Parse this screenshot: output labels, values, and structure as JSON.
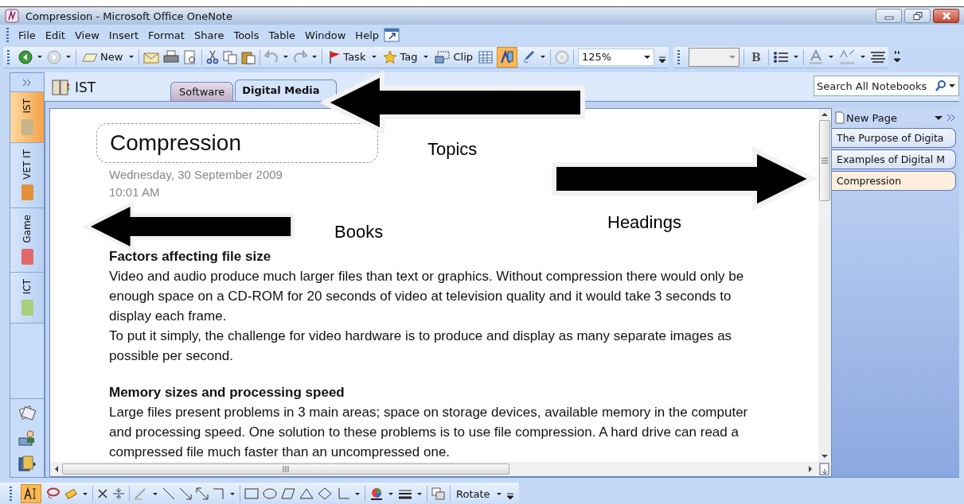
{
  "window": {
    "title": "Compression - Microsoft Office OneNote"
  },
  "menu": [
    "File",
    "Edit",
    "View",
    "Insert",
    "Format",
    "Share",
    "Tools",
    "Table",
    "Window",
    "Help"
  ],
  "standard_toolbar": {
    "new_label": "New",
    "task_label": "Task",
    "tag_label": "Tag",
    "clip_label": "Clip",
    "type_mode_on": true,
    "zoom": "125%",
    "bold_label": "B"
  },
  "notebooks": [
    {
      "name": "IST",
      "selected": true,
      "color": "#c7b48a"
    },
    {
      "name": "VET IT",
      "selected": false,
      "color": "#e0913a"
    },
    {
      "name": "Game",
      "selected": false,
      "color": "#e06a6a"
    },
    {
      "name": "ICT",
      "selected": false,
      "color": "#a9cf7c"
    }
  ],
  "notebook_title": "IST",
  "sections": [
    {
      "label": "Software",
      "selected": false
    },
    {
      "label": "Digital Media",
      "selected": true
    }
  ],
  "search": {
    "placeholder": "Search All Notebooks"
  },
  "page": {
    "title": "Compression",
    "date": "Wednesday, 30 September  2009",
    "time": "10:01 AM",
    "blocks": [
      {
        "kind": "heading",
        "text": "Factors affecting file size"
      },
      {
        "kind": "paragraph",
        "text": "Video and audio produce much larger files than text or graphics. Without compression there would only be enough space on a CD-ROM for 20 seconds of video at television quality and it would take 3 seconds to display each frame."
      },
      {
        "kind": "paragraph",
        "text": "To put it simply, the challenge for video hardware is to produce and display as many separate images as possible per second."
      },
      {
        "kind": "gap"
      },
      {
        "kind": "heading",
        "text": "Memory sizes and processing speed"
      },
      {
        "kind": "paragraph",
        "text": "Large files present problems in 3 main areas; space on storage devices, available memory in the computer and processing speed. One solution to these problems is to use file compression. A hard drive can read a compressed file much faster than an uncompressed one."
      }
    ]
  },
  "page_tabs": {
    "new_page": "New Page",
    "pages": [
      {
        "label": "The Purpose of Digita",
        "selected": false
      },
      {
        "label": "Examples of Digital M",
        "selected": false
      },
      {
        "label": "Compression",
        "selected": true
      }
    ]
  },
  "drawing_toolbar": {
    "select_tool_on": true,
    "rotate_label": "Rotate"
  },
  "annotations": [
    {
      "label": "Topics",
      "kind": "arrowleft"
    },
    {
      "label": "Books",
      "kind": "arrowleft"
    },
    {
      "label": "Headings",
      "kind": "arrowright"
    }
  ]
}
